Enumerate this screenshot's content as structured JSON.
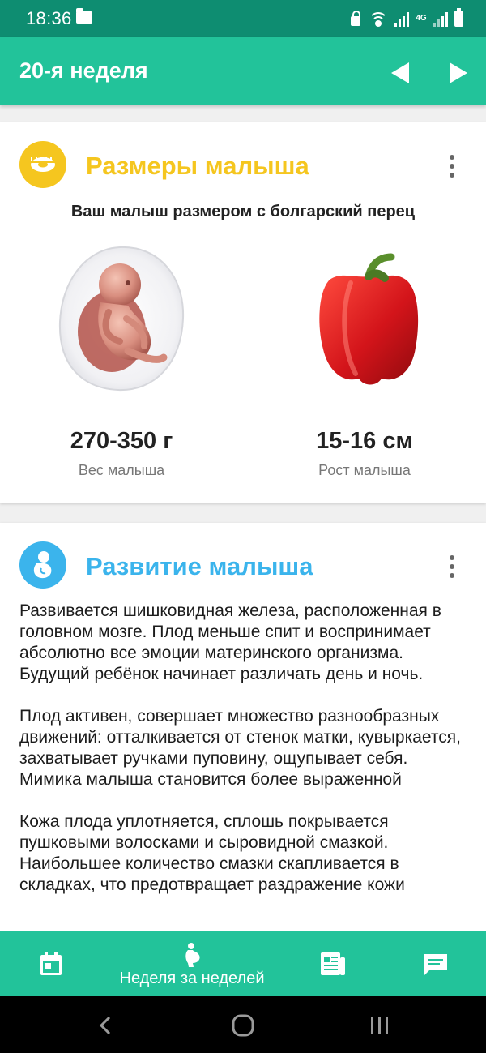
{
  "status_bar": {
    "time": "18:36",
    "network_label": "4G"
  },
  "header": {
    "title": "20-я неделя",
    "prev_icon": "triangle-left-icon",
    "next_icon": "triangle-right-icon"
  },
  "size_card": {
    "title": "Размеры малыша",
    "icon": "measuring-tape-icon",
    "subtitle": "Ваш малыш размером с болгарский перец",
    "weight_value": "270-350 г",
    "weight_label": "Вес малыша",
    "length_value": "15-16 см",
    "length_label": "Рост малыша"
  },
  "development_card": {
    "title": "Развитие малыша",
    "icon": "fetus-icon",
    "paragraphs": [
      "Развивается шишковидная железа, расположенная в головном мозге. Плод меньше спит и воспринимает абсолютно все эмоции материнского организма. Будущий ребёнок начинает различать день и ночь.",
      "Плод активен, совершает множество разнообразных движений: отталкивается от стенок матки, кувыркается, захватывает ручками пуповину, ощупывает себя. Мимика малыша становится более выраженной",
      "Кожа плода уплотняется, сплошь покрывается пушковыми волосками и сыровидной смазкой. Наибольшее количество смазки скапливается в складках, что предотвращает раздражение кожи"
    ]
  },
  "bottom_nav": {
    "tabs": [
      {
        "icon": "calendar-icon",
        "label": ""
      },
      {
        "icon": "pregnant-icon",
        "label": "Неделя за неделей"
      },
      {
        "icon": "articles-icon",
        "label": ""
      },
      {
        "icon": "chat-icon",
        "label": ""
      }
    ]
  },
  "colors": {
    "status_bar": "#0e8d71",
    "primary": "#22c39a",
    "size_accent": "#f5c61f",
    "development_accent": "#3bb4ec"
  }
}
